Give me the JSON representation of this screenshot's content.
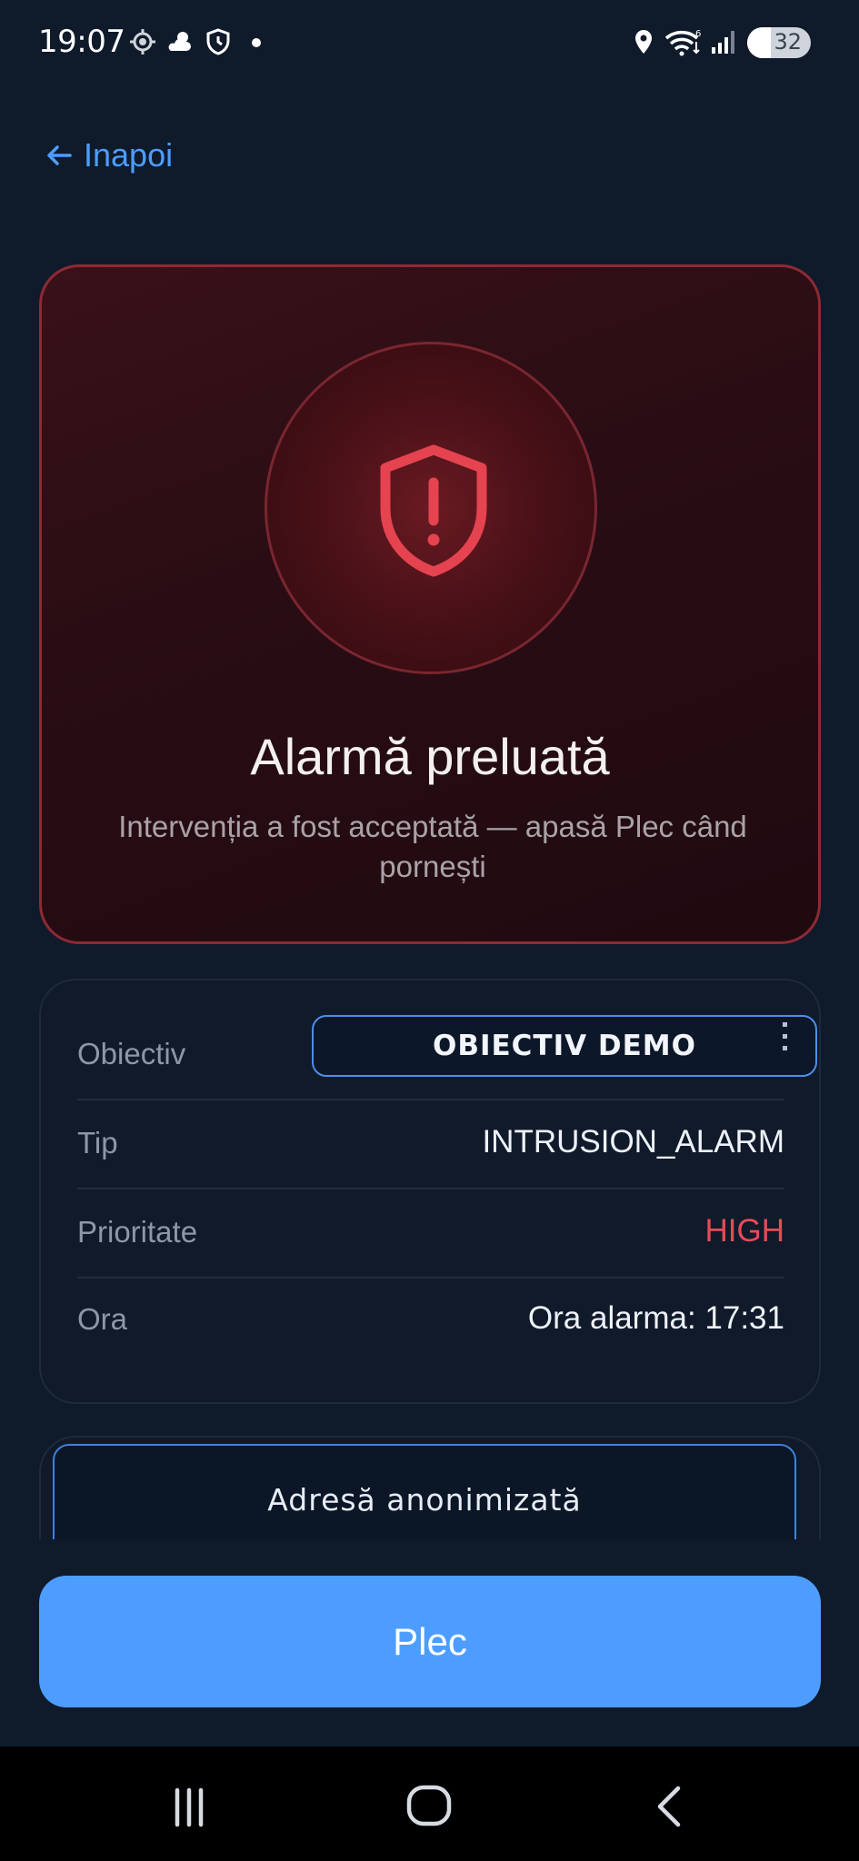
{
  "status_bar": {
    "time": "19:07",
    "battery": "32",
    "icons": [
      "location-target-icon",
      "weather-icon",
      "shield-clock-icon",
      "location-pin-icon",
      "wifi-icon",
      "signal-icon",
      "battery-icon"
    ]
  },
  "nav": {
    "back_label": "Inapoi"
  },
  "alarm": {
    "title": "Alarmă preluată",
    "subtitle": "Intervenția a fost acceptată — apasă Plec când pornești",
    "icon": "shield-alert-icon",
    "accent_color": "#e5434f"
  },
  "details": {
    "rows": [
      {
        "label": "Obiectiv",
        "value": "OBIECTIV DEMO"
      },
      {
        "label": "Tip",
        "value": "INTRUSION_ALARM"
      },
      {
        "label": "Prioritate",
        "value": "HIGH"
      },
      {
        "label": "Ora",
        "value": "Ora alarma: 17:31"
      }
    ]
  },
  "address": {
    "value": "Adresă anonimizată"
  },
  "actions": {
    "primary_label": "Plec",
    "primary_color": "#4d9dff"
  },
  "system_nav": {
    "icons": [
      "recents-icon",
      "home-icon",
      "back-icon"
    ]
  }
}
